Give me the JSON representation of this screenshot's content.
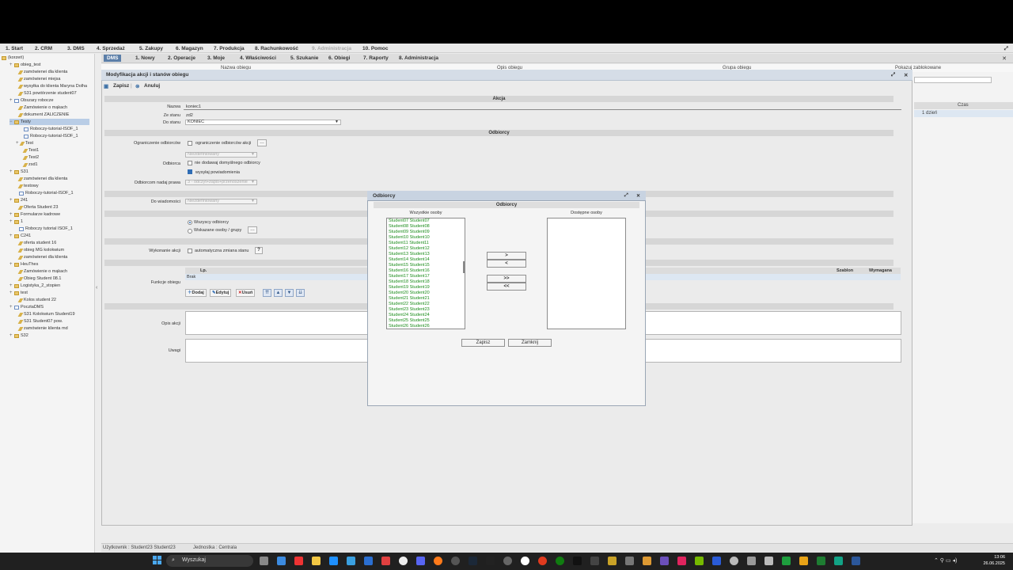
{
  "top_menu": [
    "1. Start",
    "2. CRM",
    "3. DMS",
    "4. Sprzedaż",
    "5. Zakupy",
    "6. Magazyn",
    "7. Produkcja",
    "8. Rachunkowość",
    "9. Administracja",
    "10. Pomoc"
  ],
  "dms_menu": [
    "DMS",
    "1. Nowy",
    "2. Operacje",
    "3. Moje",
    "4. Właściwości",
    "5. Szukanie",
    "6. Obiegi",
    "7. Raporty",
    "8. Administracja"
  ],
  "tree": [
    "(korzeń)",
    "obieg_test",
    "zamówienei dla klienta",
    "zamówienei miejsa",
    "wysyłka do klienta Maryna Dolha",
    "S31 powtórzenie student07",
    "Obszary robocze",
    "Zamówienie o mąkach",
    "dokument ZALICZENIE",
    "Testy",
    "Roboczy-tutorial-ISOF_1",
    "Roboczy-tutorial-ISOF_1",
    "Test",
    "Test1",
    "Test2",
    "zsd1",
    "S31",
    "zamówienei dla klienta",
    "testowy",
    "Roboczy-tutorial-ISOF_1",
    "241",
    "Oferta Student 23",
    "Formularze kadrowe",
    "1",
    "Roboczy tutorial ISOF_1",
    "C241",
    "oferta student 16",
    "obieg MG kolokwium",
    "zamówienei dla klienta",
    "HeuThes",
    "Zamówienie o mąkach",
    "Obieg Student 08.1",
    "Logistyka_2_stopien",
    "test",
    "Kolos student 22",
    "PocztaDMS",
    "S31 Kolokwium Student19",
    "S31 Student07 pow.",
    "zamówienie klienta md",
    "S32"
  ],
  "bg_grid": {
    "col1": "Nazwa obiegu",
    "col2": "Opis obiegu",
    "col3": "Grupa obiegu",
    "col4": "Pokazuj zablokowane",
    "czas_header": "Czas",
    "czas_value": "1 dzień"
  },
  "form": {
    "title": "Modyfikacja akcji i stanów obiegu",
    "save": "Zapisz",
    "cancel": "Anuluj",
    "sect_akcja": "Akcja",
    "nazwa_label": "Nazwa",
    "nazwa_value": "koniec1",
    "ze_stanu_label": "Ze stanu",
    "ze_stanu_value": "zd2",
    "do_stanu_label": "Do stanu",
    "do_stanu_value": "KONIEC",
    "sect_odbiorcy": "Odbiorcy",
    "ogr_label": "Ograniczenie odbiorców",
    "ogr_cb": "ograniczenie odbiorców akcji",
    "ogr_select": "Niezdefiniowany",
    "odbiorca_label": "Odbiorca",
    "odbiorca_cb1": "nie dodawaj domyślnego odbiorcy",
    "odbiorca_cb2": "wysyłaj powiadomienia",
    "prawa_label": "Odbiorcom nadaj prawa",
    "prawa_value": "3 - odczyt+zapis+przenoszenie",
    "wiad_label": "Do wiadomości",
    "wiad_value": "Niezdefiniowany",
    "radio1": "Wszyscy odbiorcy",
    "radio2": "Wskazane osoby / grupy",
    "wykonanie_label": "Wykonanie akcji",
    "wykonanie_cb": "automatyczna zmiana stanu",
    "funkcje_label": "Funkcje obiegu",
    "col_lp": "Lp.",
    "col_szablon": "Szablon",
    "col_wymagana": "Wymagana",
    "row_brak": "Brak",
    "btn_dodaj": "Dodaj",
    "btn_edytuj": "Edytuj",
    "btn_usun": "Usuń",
    "opis_label": "Opis akcji",
    "uwagi_label": "Uwagi"
  },
  "modal": {
    "title": "Odbiorcy",
    "subtitle": "Odbiorcy",
    "left_header": "Wszystkie osoby",
    "right_header": "Dostępne osoby",
    "btn_add": ">",
    "btn_remove": "<",
    "btn_add_all": ">>",
    "btn_remove_all": "<<",
    "save": "Zapisz",
    "close": "Zamknij",
    "people": [
      "Student07 Student07",
      "Student08 Student08",
      "Student09 Student09",
      "Student10 Student10",
      "Student11 Student11",
      "Student12 Student12",
      "Student13 Student13",
      "Student14 Student14",
      "Student15 Student15",
      "Student16 Student16",
      "Student17 Student17",
      "Student18 Student18",
      "Student19 Student19",
      "Student20 Student20",
      "Student21 Student21",
      "Student22 Student22",
      "Student23 Student23",
      "Student24 Student24",
      "Student25 Student25",
      "Student26 Student26"
    ]
  },
  "status": {
    "user": "Użytkownik : Student23 Student23",
    "unit": "Jednostka : Centrala"
  },
  "taskbar": {
    "search": "Wyszukaj",
    "time": "13:06",
    "date": "26.06.2025"
  }
}
